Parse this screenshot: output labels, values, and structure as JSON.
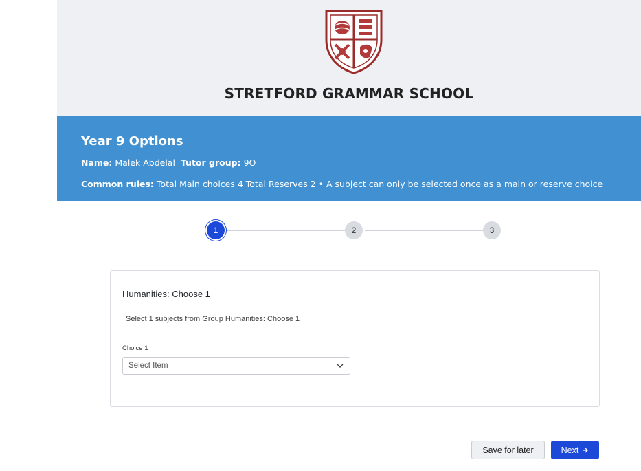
{
  "school": {
    "logo_icon": "school-crest-icon",
    "name": "STRETFORD GRAMMAR SCHOOL"
  },
  "header": {
    "title": "Year 9 Options",
    "name_label": "Name:",
    "name_value": "Malek Abdelal",
    "tutor_label": "Tutor group:",
    "tutor_value": "9O",
    "rules_label": "Common rules:",
    "rules_value": "Total Main choices 4 Total Reserves 2 • A subject can only be selected once as a main or reserve choice"
  },
  "stepper": {
    "steps": [
      {
        "label": "1",
        "state": "active"
      },
      {
        "label": "2",
        "state": "inactive"
      },
      {
        "label": "3",
        "state": "inactive"
      }
    ]
  },
  "group": {
    "title": "Humanities: Choose 1",
    "description": "Select 1 subjects from Group Humanities: Choose 1",
    "choices": [
      {
        "label": "Choice 1",
        "placeholder": "Select Item",
        "icon": "chevron-down-icon"
      }
    ]
  },
  "actions": {
    "save_label": "Save for later",
    "next_label": "Next",
    "next_icon": "arrow-right-icon"
  },
  "colors": {
    "header_band": "#4191d2",
    "primary": "#1d49d8",
    "crest_red": "#9b2c2c"
  }
}
